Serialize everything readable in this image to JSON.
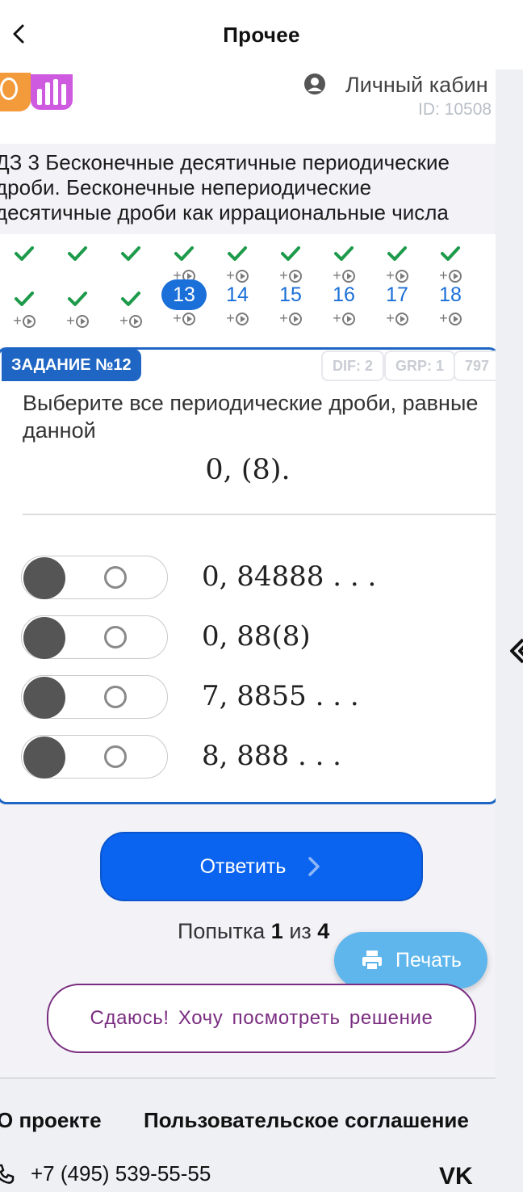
{
  "topbar": {
    "title": "Прочее"
  },
  "header": {
    "account_label": "Личный кабин",
    "user_id": "ID: 10508"
  },
  "task": {
    "title_lines": [
      "ДЗ 3 Бесконечные десятичные периодические",
      "дроби. Бесконечные непериодические",
      "десятичные дроби как иррациональные числа"
    ],
    "badge": "ЗАДАНИЕ №12",
    "tags": [
      "DIF: 2",
      "GRP: 1",
      "797"
    ],
    "question": "Выберите все периодические дроби, равные данной",
    "formula": "0, (8).",
    "options": [
      "0, 84888 . . .",
      "0, 88(8)",
      "7, 8855 . . .",
      "8, 888 . . ."
    ]
  },
  "nav": {
    "top_row_checks": 9,
    "bottom_numbers": [
      "13",
      "14",
      "15",
      "16",
      "17",
      "18"
    ],
    "plus": "+"
  },
  "actions": {
    "submit": "Ответить",
    "attempt_prefix": "Попытка",
    "attempt_current": "1",
    "attempt_sep": "из",
    "attempt_total": "4",
    "print": "Печать",
    "give_up": "Сдаюсь! Хочу посмотреть решение"
  },
  "footer": {
    "about": "О проекте",
    "agreement": "Пользовательское соглашение",
    "phone": "+7 (495) 539-55-55",
    "vk": "VK"
  },
  "colors": {
    "accent": "#1f66c4",
    "button": "#0b64f0",
    "print": "#5fb6ec",
    "give_up": "#7a2d80",
    "check": "#1d9a4a"
  }
}
